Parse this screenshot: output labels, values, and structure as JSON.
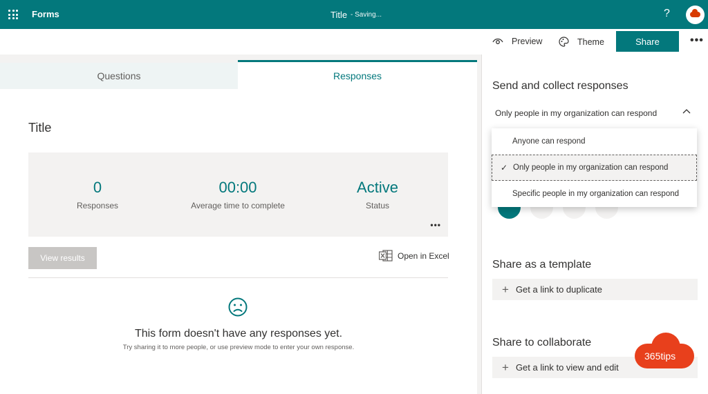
{
  "topbar": {
    "app_name": "Forms",
    "doc_title": "Title",
    "saving": "- Saving...",
    "help": "?",
    "accent": "#03787c"
  },
  "commands": {
    "preview": "Preview",
    "theme": "Theme",
    "share": "Share",
    "more": "•••"
  },
  "tabs": {
    "questions": "Questions",
    "responses": "Responses"
  },
  "form": {
    "title": "Title",
    "stats": [
      {
        "value": "0",
        "label": "Responses"
      },
      {
        "value": "00:00",
        "label": "Average time to complete"
      },
      {
        "value": "Active",
        "label": "Status"
      }
    ],
    "stats_more": "•••",
    "view_results": "View results",
    "open_excel": "Open in Excel",
    "empty_title": "This form doesn't have any responses yet.",
    "empty_subtitle": "Try sharing it to more people, or use preview mode to enter your own response."
  },
  "side": {
    "send_heading": "Send and collect responses",
    "permission": "Only people in my organization can respond",
    "dropdown_options": [
      {
        "label": "Anyone can respond",
        "selected": false
      },
      {
        "label": "Only people in my organization can respond",
        "selected": true
      },
      {
        "label": "Specific people in my organization can respond",
        "selected": false
      }
    ],
    "template_heading": "Share as a template",
    "duplicate_link": "Get a link to duplicate",
    "collab_heading": "Share to collaborate",
    "edit_link": "Get a link to view and edit"
  },
  "watermark": {
    "text": "365tips"
  }
}
